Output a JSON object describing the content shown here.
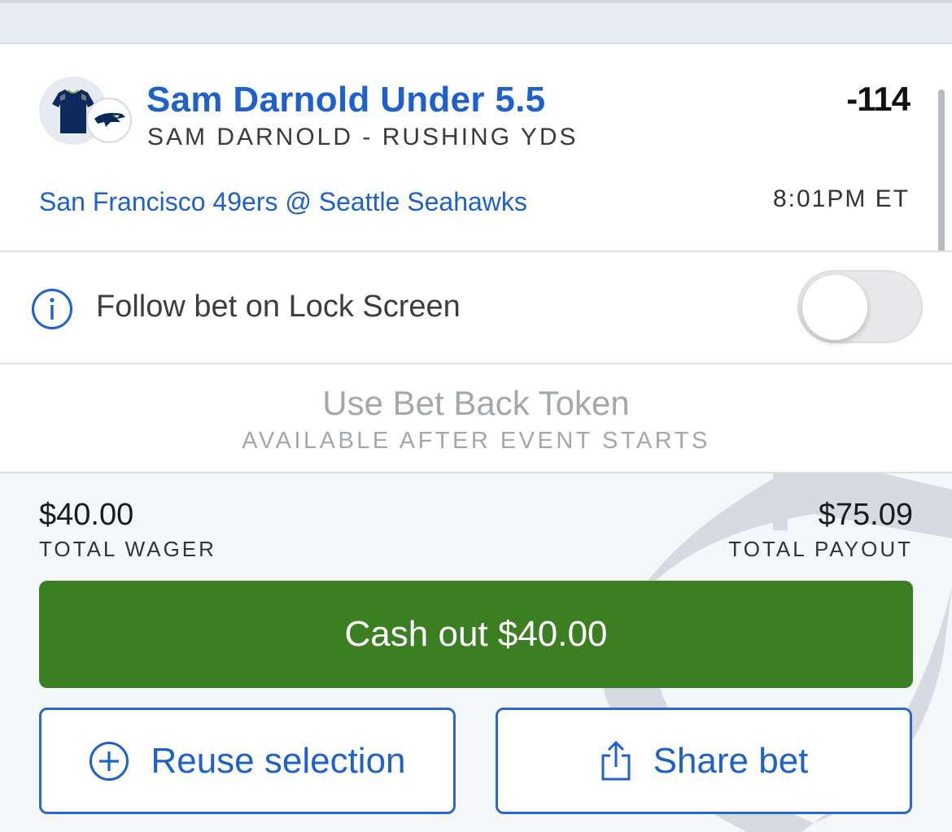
{
  "bet": {
    "title": "Sam Darnold Under 5.5",
    "market": "SAM DARNOLD - RUSHING YDS",
    "odds": "-114",
    "game": "San Francisco 49ers @ Seattle Seahawks",
    "time": "8:01PM ET",
    "icons": [
      "jersey-icon",
      "seahawks-logo"
    ]
  },
  "follow": {
    "label": "Follow bet on Lock Screen",
    "toggle_on": false,
    "icon": "info-icon"
  },
  "token": {
    "title": "Use Bet Back Token",
    "subtitle": "AVAILABLE AFTER EVENT STARTS"
  },
  "summary": {
    "wager_amount": "$40.00",
    "wager_label": "TOTAL WAGER",
    "payout_amount": "$75.09",
    "payout_label": "TOTAL PAYOUT"
  },
  "actions": {
    "cashout_label": "Cash out $40.00",
    "reuse_label": "Reuse selection",
    "share_label": "Share bet"
  },
  "colors": {
    "accent_blue": "#1d61c9",
    "cashout_green": "#3b7f22",
    "muted_gray": "#a4a7ab"
  }
}
